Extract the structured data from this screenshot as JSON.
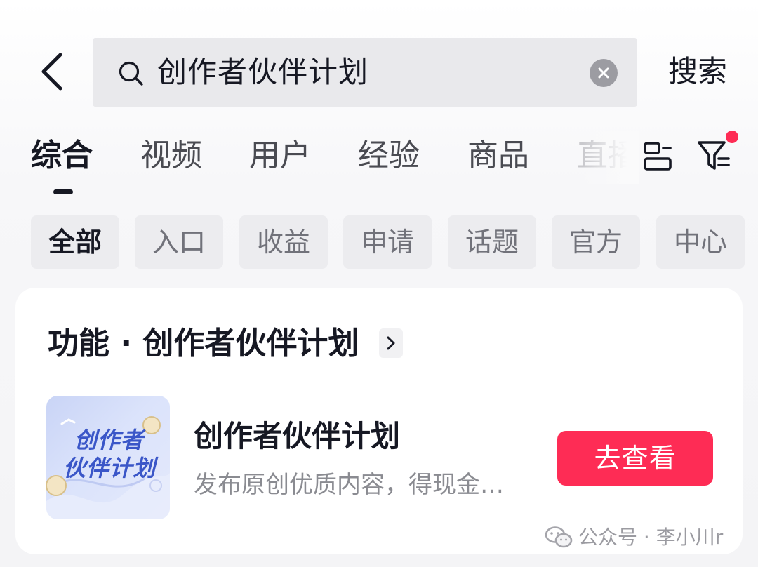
{
  "search": {
    "query": "创作者伙伴计划",
    "submit_label": "搜索"
  },
  "tabs": [
    {
      "label": "综合",
      "active": true
    },
    {
      "label": "视频"
    },
    {
      "label": "用户"
    },
    {
      "label": "经验"
    },
    {
      "label": "商品"
    },
    {
      "label": "直播"
    }
  ],
  "filter_badge_color": "#fe2c55",
  "chips": [
    {
      "label": "全部",
      "active": true
    },
    {
      "label": "入口"
    },
    {
      "label": "收益"
    },
    {
      "label": "申请"
    },
    {
      "label": "话题"
    },
    {
      "label": "官方"
    },
    {
      "label": "中心"
    }
  ],
  "card": {
    "title": "功能 · 创作者伙伴计划",
    "thumb_lines": [
      "创作者",
      "伙伴计划"
    ],
    "item_title": "创作者伙伴计划",
    "item_desc": "发布原创优质内容，得现金…",
    "cta_label": "去查看",
    "cta_color": "#fe2c55"
  },
  "watermark": "公众号 · 李小川r"
}
